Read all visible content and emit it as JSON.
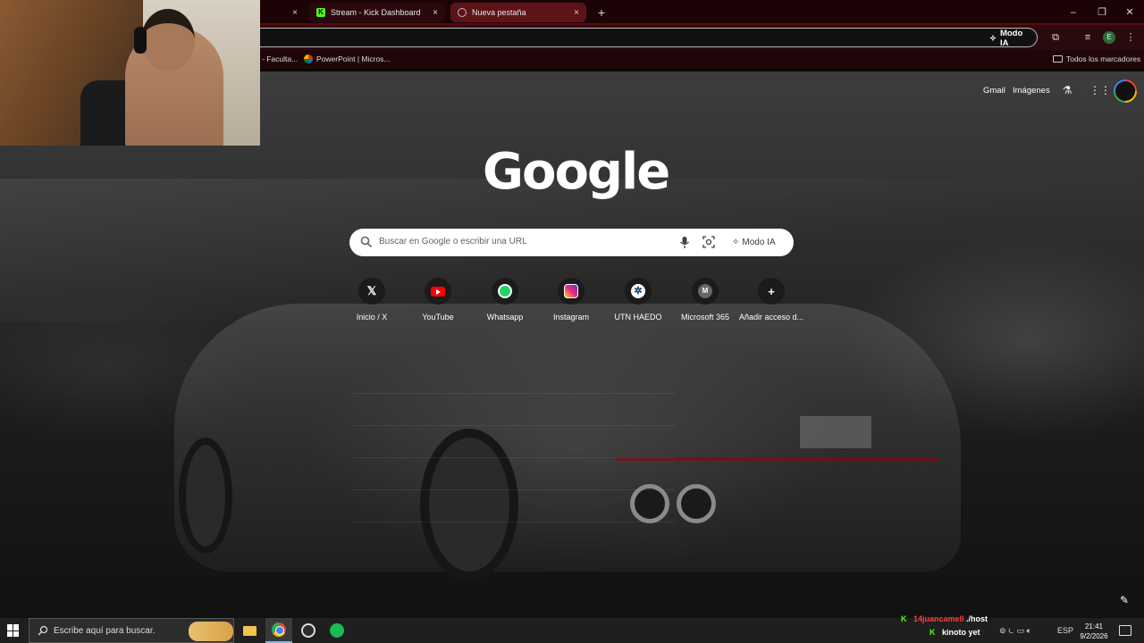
{
  "tabs": {
    "kick_title": "Stream - Kick Dashboard",
    "new_tab_title": "Nueva pestaña",
    "close_glyph": "×",
    "new_tab_glyph": "+"
  },
  "window_controls": {
    "minimize": "–",
    "maximize": "❐",
    "close": "✕"
  },
  "toolbar": {
    "ai_mode_label": "Modo IA",
    "menu_glyph": "⋮",
    "profile_initial": "E"
  },
  "bookmarks": {
    "item1": "- Faculta...",
    "item2": "PowerPoint | Micros...",
    "all_bookmarks": "Todos los marcadores"
  },
  "ntp": {
    "gmail": "Gmail",
    "images": "Imágenes",
    "logo": "Google",
    "search_placeholder": "Buscar en Google o escribir una URL",
    "ai_mode": "Modo IA",
    "shortcuts": [
      {
        "label": "Inicio / X",
        "glyph": "𝕏"
      },
      {
        "label": "YouTube"
      },
      {
        "label": "Whatsapp"
      },
      {
        "label": "Instagram"
      },
      {
        "label": "UTN HAEDO",
        "glyph": "✲"
      },
      {
        "label": "Microsoft 365",
        "glyph": "M"
      },
      {
        "label": "Añadir acceso d...",
        "glyph": "+"
      }
    ]
  },
  "taskbar": {
    "search_placeholder": "Escribe aquí para buscar.",
    "chat_line1_user": "14juancamell",
    "chat_line1_text": "./host",
    "chat_line2_user": "kinoto",
    "chat_line2_text": "yet",
    "lang": "ESP",
    "time": "21:41",
    "date": "9/2/2026"
  },
  "colors": {
    "kick_green": "#53fc18",
    "chat_user_red": "#ff3b3b",
    "tab_active": "#5d1318"
  }
}
